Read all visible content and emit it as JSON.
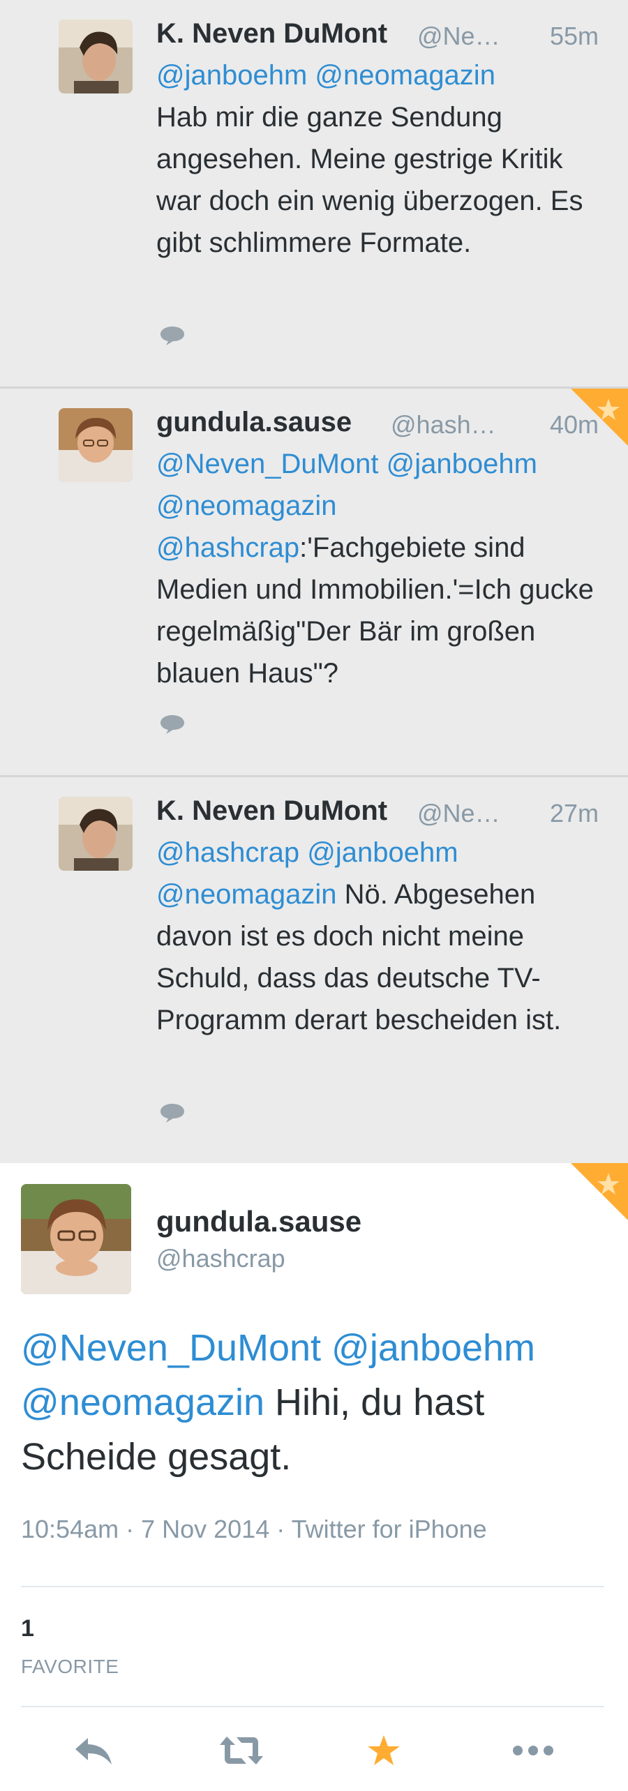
{
  "tweets": [
    {
      "name": "K. Neven DuMont",
      "handle": "@Ne…",
      "time": "55m",
      "mentions": "@janboehm @neomagazin",
      "text": "Hab mir die ganze Sendung angesehen. Meine gestrige Kritik war doch ein wenig überzogen. Es gibt schlimmere Formate.",
      "favorited": false
    },
    {
      "name": "gundula.sause",
      "handle": "@hash…",
      "time": "40m",
      "mentions": "@Neven_DuMont @janboehm @neomagazin @hashcrap",
      "text": ":'Fachgebiete sind Medien und Immobilien.'=Ich gucke regelmäßig\"Der Bär im großen blauen Haus\"?",
      "favorited": true
    },
    {
      "name": "K. Neven DuMont",
      "handle": "@Ne…",
      "time": "27m",
      "mentions": "@hashcrap @janboehm @neomagazin",
      "text": " Nö. Abgesehen davon ist es doch nicht meine Schuld, dass das deutsche TV-Programm derart bescheiden ist.",
      "favorited": false
    }
  ],
  "main": {
    "name": "gundula.sause",
    "handle": "@hashcrap",
    "mentions": "@Neven_DuMont @janboehm @neomagazin",
    "text": " Hihi, du hast Scheide gesagt.",
    "meta": "10:54am · 7 Nov 2014 · Twitter for iPhone",
    "fav_count": "1",
    "fav_label": "FAVORITE"
  },
  "colors": {
    "link": "#2e8dd3",
    "fav": "#ffac33",
    "muted": "#8899a6"
  },
  "icons": [
    "reply-icon",
    "retweet-icon",
    "star-icon",
    "more-icon"
  ]
}
